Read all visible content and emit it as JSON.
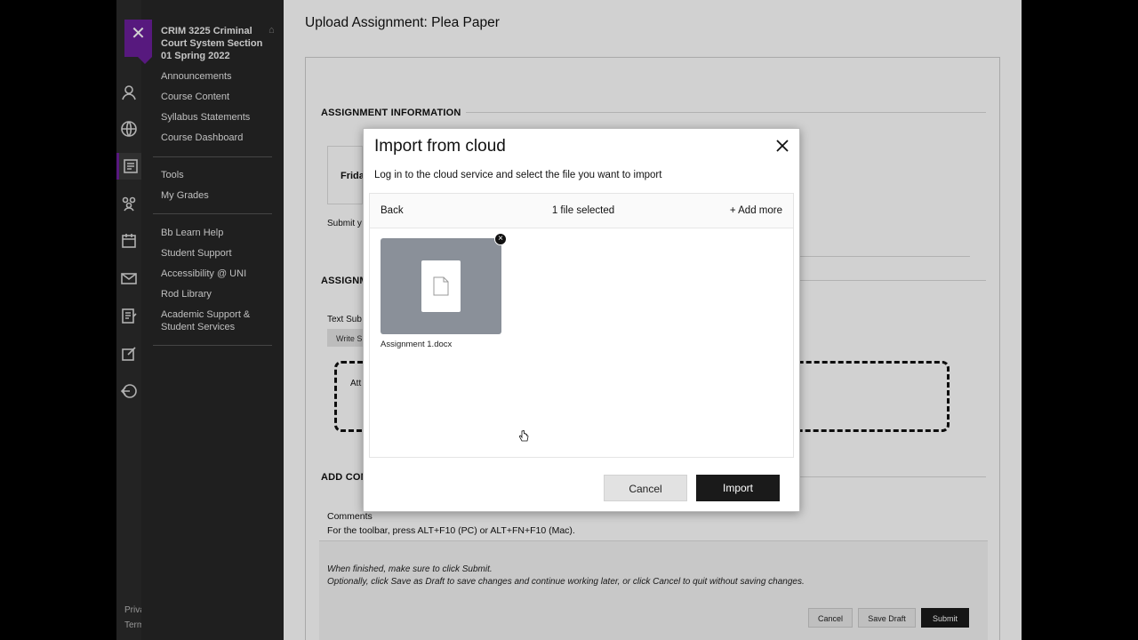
{
  "course_menu": {
    "course_title": "CRIM 3225 Criminal Court System Section 01 Spring 2022",
    "group1": [
      "Announcements",
      "Course Content",
      "Syllabus Statements",
      "Course Dashboard"
    ],
    "group2": [
      "Tools",
      "My Grades"
    ],
    "group3": [
      "Bb Learn Help",
      "Student Support",
      "Accessibility @ UNI",
      "Rod Library",
      "Academic Support & Student Services"
    ]
  },
  "rail": {
    "footer": [
      "Priva",
      "Term"
    ],
    "icons": [
      "user-icon",
      "globe-icon",
      "courses-icon",
      "groups-icon",
      "calendar-icon",
      "mail-icon",
      "grades-icon",
      "edit-icon",
      "sign-out-icon"
    ]
  },
  "page": {
    "title": "Upload Assignment: Plea Paper",
    "assignment_info_heading": "ASSIGNMENT INFORMATION",
    "date_partial": "Frida",
    "submit_partial": "Submit y",
    "assignment_sub_heading": "ASSIGNM",
    "text_sub_label": "Text Sub",
    "write_btn": "Write S",
    "attach_partial": "Att",
    "add_comments_heading": "ADD COM",
    "comments_label": "Comments",
    "toolbar_hint": "For the toolbar, press ALT+F10 (PC) or ALT+FN+F10 (Mac).",
    "footer_line1": "When finished, make sure to click Submit.",
    "footer_line2": "Optionally, click Save as Draft to save changes and continue working later, or click Cancel to quit without saving changes.",
    "cancel_label": "Cancel",
    "save_draft_label": "Save Draft",
    "submit_label": "Submit"
  },
  "modal": {
    "title": "Import from cloud",
    "subtitle": "Log in to the cloud service and select the file you want to import",
    "back_label": "Back",
    "count_label": "1 file selected",
    "add_more_label": "Add more",
    "file_name": "Assignment 1.docx",
    "cancel_label": "Cancel",
    "import_label": "Import"
  }
}
